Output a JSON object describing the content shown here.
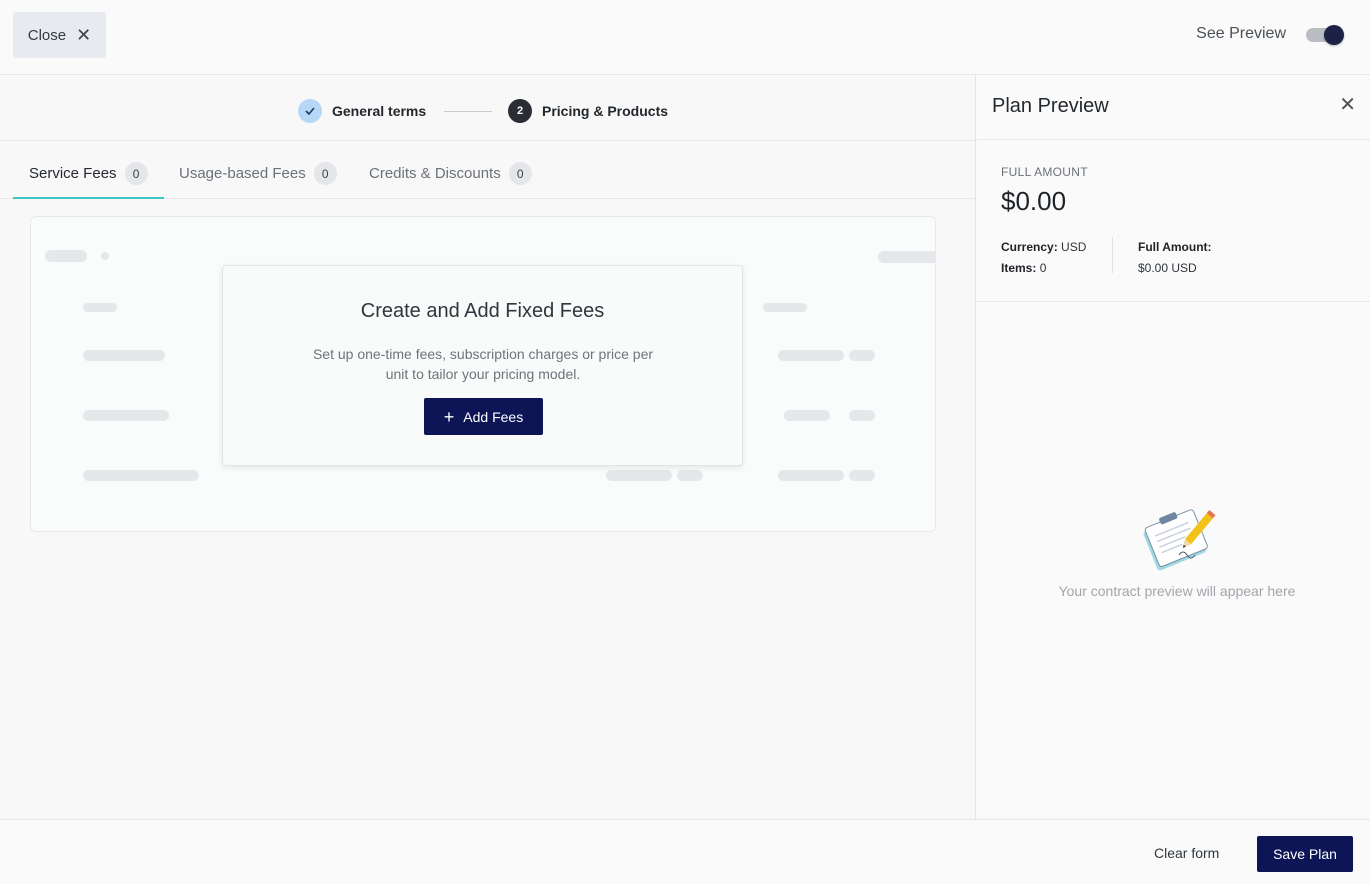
{
  "topbar": {
    "close_label": "Close",
    "see_preview_label": "See Preview",
    "preview_toggle_on": true
  },
  "stepper": {
    "steps": [
      {
        "label": "General terms",
        "state": "completed"
      },
      {
        "label": "Pricing & Products",
        "number": "2",
        "state": "active"
      }
    ]
  },
  "tabs": [
    {
      "label": "Service Fees",
      "count": "0",
      "active": true
    },
    {
      "label": "Usage-based Fees",
      "count": "0",
      "active": false
    },
    {
      "label": "Credits & Discounts",
      "count": "0",
      "active": false
    }
  ],
  "empty_state": {
    "title": "Create and Add Fixed Fees",
    "description": "Set up one-time fees, subscription charges or price per unit to tailor your pricing model.",
    "button_label": "Add Fees"
  },
  "preview": {
    "title": "Plan Preview",
    "full_amount_label": "FULL AMOUNT",
    "full_amount_value": "$0.00",
    "currency_label": "Currency:",
    "currency_value": "USD",
    "items_label": "Items:",
    "items_value": "0",
    "full_amount_meta_label": "Full Amount:",
    "full_amount_meta_value": "$0.00 USD",
    "placeholder_text": "Your contract preview will appear here"
  },
  "footer": {
    "clear_label": "Clear form",
    "save_label": "Save Plan"
  },
  "colors": {
    "primary": "#0d1557",
    "tab_indicator": "#3cc7c1",
    "completed_step": "#b7d7f7"
  }
}
